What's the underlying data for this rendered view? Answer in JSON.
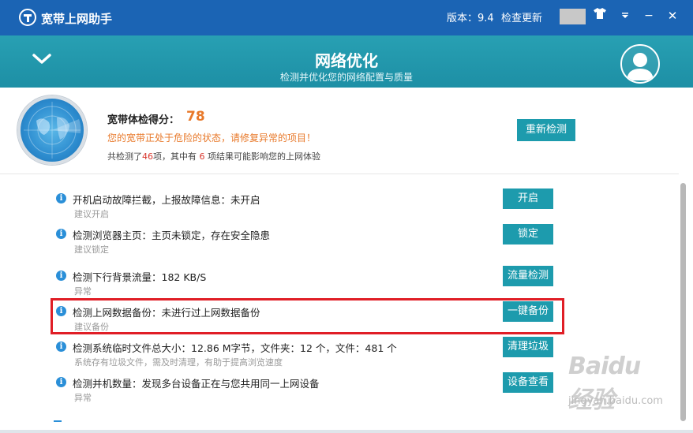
{
  "app": {
    "title": "宽带上网助手"
  },
  "titlebar": {
    "version_label": "版本：9.4",
    "check_update": "检查更新",
    "shirt_icon": "shirt-icon",
    "menu_icon": "dropdown-icon",
    "minimize_glyph": "−",
    "close_glyph": "✕"
  },
  "banner": {
    "title": "网络优化",
    "subtitle": "检测并优化您的网络配置与质量"
  },
  "summary": {
    "score_label": "宽带体检得分：",
    "score": "78",
    "warning": "您的宽带正处于危险的状态，请修复异常的项目！",
    "stats_prefix": "共检测了",
    "total": "46",
    "stats_mid": "项，其中有 ",
    "issues": "6",
    "stats_suffix": " 项结果可能影响您的上网体验",
    "recheck_button": "重新检测"
  },
  "items": [
    {
      "title": "开机启动故障拦截，上报故障信息：未开启",
      "sub": "建议开启",
      "button": "开启"
    },
    {
      "title": "检测浏览器主页：主页未锁定，存在安全隐患",
      "sub": "建议锁定",
      "button": "锁定"
    },
    {
      "title": "检测下行背景流量：182 KB/S",
      "sub": "异常",
      "button": "流量检测"
    },
    {
      "title": "检测上网数据备份：未进行过上网数据备份",
      "sub": "建议备份",
      "button": "一键备份"
    },
    {
      "title": "检测系统临时文件总大小：12.86 M字节，文件夹：12 个，文件：481 个",
      "sub": "系统存有垃圾文件，需及时清理，有助于提高浏览速度",
      "button": "清理垃圾"
    },
    {
      "title": "检测并机数量：发现多台设备正在与您共用同一上网设备",
      "sub": "异常",
      "button": "设备查看"
    }
  ],
  "watermark": {
    "logo": "Baidu经验",
    "sub": "jingyan.baidu.com"
  },
  "colors": {
    "titlebar": "#1b64b4",
    "banner": "#1d8fa5",
    "accent_button": "#1d9bad",
    "score": "#e8792a",
    "highlight": "#e01e26"
  }
}
